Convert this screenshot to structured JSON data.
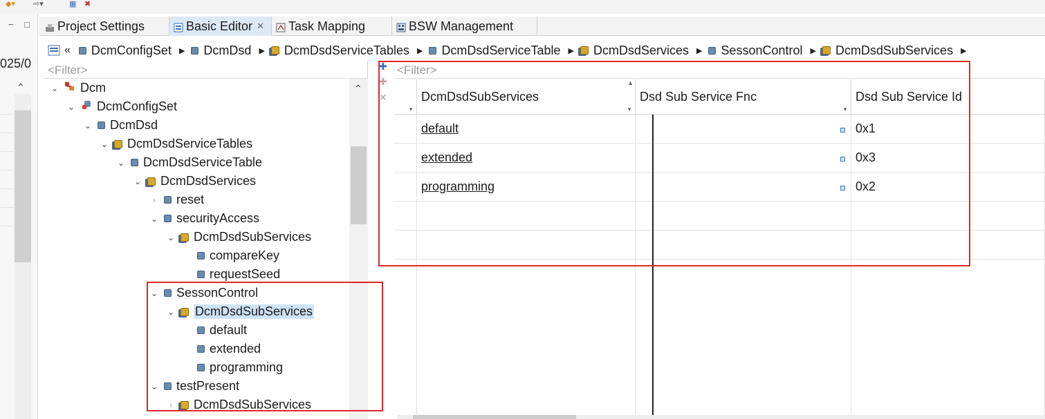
{
  "tabs": [
    {
      "label": "Project Settings",
      "icon": "wrench-icon"
    },
    {
      "label": "Basic Editor",
      "icon": "editor-icon",
      "active": true
    },
    {
      "label": "Task Mapping",
      "icon": "task-icon"
    },
    {
      "label": "BSW Management",
      "icon": "bsw-icon"
    }
  ],
  "left_stub": {
    "date_fragment": "025/0"
  },
  "breadcrumb": [
    "DcmConfigSet",
    "DcmDsd",
    "DcmDsdServiceTables",
    "DcmDsdServiceTable",
    "DcmDsdServices",
    "SessonControl",
    "DcmDsdSubServices"
  ],
  "tree": {
    "filter_placeholder": "<Filter>",
    "nodes": [
      {
        "label": "Dcm",
        "kind": "module",
        "expander": "open"
      },
      {
        "label": "DcmConfigSet",
        "kind": "config",
        "expander": "open"
      },
      {
        "label": "DcmDsd",
        "kind": "object",
        "expander": "open"
      },
      {
        "label": "DcmDsdServiceTables",
        "kind": "container",
        "expander": "open"
      },
      {
        "label": "DcmDsdServiceTable",
        "kind": "object",
        "expander": "open"
      },
      {
        "label": "DcmDsdServices",
        "kind": "container",
        "expander": "open"
      },
      {
        "label": "reset",
        "kind": "object",
        "expander": "closed"
      },
      {
        "label": "securityAccess",
        "kind": "object",
        "expander": "open"
      },
      {
        "label": "DcmDsdSubServices",
        "kind": "container",
        "expander": "open"
      },
      {
        "label": "compareKey",
        "kind": "object",
        "expander": "none"
      },
      {
        "label": "requestSeed",
        "kind": "object",
        "expander": "none"
      },
      {
        "label": "SessonControl",
        "kind": "object",
        "expander": "open"
      },
      {
        "label": "DcmDsdSubServices",
        "kind": "container",
        "expander": "open",
        "selected": true
      },
      {
        "label": "default",
        "kind": "object",
        "expander": "none"
      },
      {
        "label": "extended",
        "kind": "object",
        "expander": "none"
      },
      {
        "label": "programming",
        "kind": "object",
        "expander": "none"
      },
      {
        "label": "testPresent",
        "kind": "object",
        "expander": "open"
      },
      {
        "label": "DcmDsdSubServices",
        "kind": "container",
        "expander": "closed"
      }
    ]
  },
  "table": {
    "filter_placeholder": "<Filter>",
    "columns": [
      "DcmDsdSubServices",
      "Dsd Sub Service Fnc",
      "Dsd Sub Service Id"
    ],
    "rows": [
      {
        "name": "default",
        "fnc": "",
        "id": "0x1"
      },
      {
        "name": "extended",
        "fnc": "",
        "id": "0x3"
      },
      {
        "name": "programming",
        "fnc": "",
        "id": "0x2"
      }
    ]
  },
  "colors": {
    "highlight": "#e0262b",
    "selection": "#cfe3f8",
    "active_tab": "#dde8f5"
  }
}
